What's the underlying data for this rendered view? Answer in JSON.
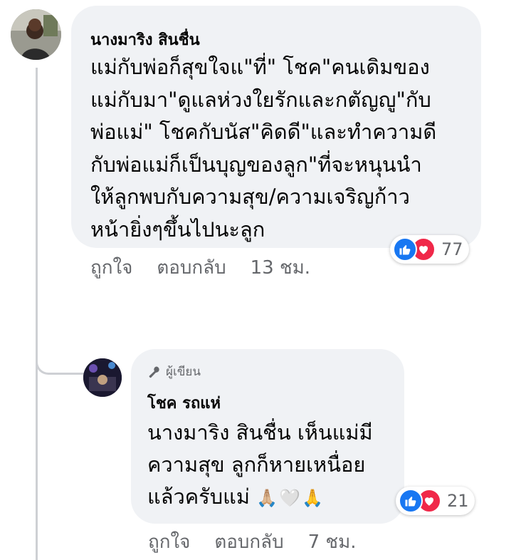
{
  "comment": {
    "author": "นางมาริง สินชื่น",
    "lines": [
      "แม่กับพ่อก็สุขใจแ\"ที่\" โชค\"คนเดิมของ",
      "แม่กับมา\"ดูแลห่วงใยรักและกตัญญู\"กับ",
      "พ่อแม่\" โชคกับนัส\"คิดดี\"และทำความดี",
      "กับพ่อแม่ก็เป็นบุญของลูก\"ที่จะหนุนนำ",
      "ให้ลูกพบกับความสุข/ความเจริญก้าว",
      "หน้ายิ่งๆขึ้นไปนะลูก"
    ],
    "reaction_count": "77",
    "actions": {
      "like": "ถูกใจ",
      "reply": "ตอบกลับ",
      "time": "13 ชม."
    }
  },
  "reply": {
    "badge": "ผู้เขียน",
    "author": "โชค รถแห่",
    "lines": [
      "นางมาริง สินชื่น เห็นแม่มี",
      "ความสุข ลูกก็หายเหนื่อย",
      "แล้วครับแม่"
    ],
    "emojis": "🙏🏼🤍🙏",
    "reaction_count": "21",
    "actions": {
      "like": "ถูกใจ",
      "reply": "ตอบกลับ",
      "time": "7 ชม."
    }
  },
  "icons": {
    "badge_icon": "microphone-icon",
    "like_icon": "thumbs-up-icon",
    "love_icon": "heart-icon"
  },
  "colors": {
    "bubble": "#f0f2f5",
    "secondary_text": "#65676b",
    "like": "#1877f2",
    "love": "#f02849"
  }
}
